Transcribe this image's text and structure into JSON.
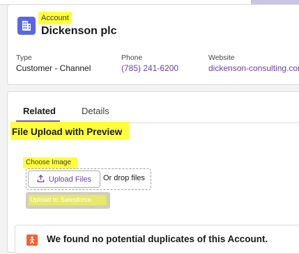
{
  "account": {
    "object_label": "Account",
    "name": "Dickenson plc",
    "fields": [
      {
        "label": "Type",
        "value": "Customer - Channel"
      },
      {
        "label": "Phone",
        "value": "(785) 241-6200"
      },
      {
        "label": "Website",
        "value": "dickenson-consulting.com"
      }
    ],
    "icon": "building-icon"
  },
  "tabs": [
    {
      "label": "Related",
      "active": true
    },
    {
      "label": "Details",
      "active": false
    }
  ],
  "upload": {
    "title": "File Upload with Preview",
    "choose_label": "Choose Image",
    "upload_button_label": "Upload Files",
    "upload_icon": "upload-icon",
    "drop_text": "Or drop files",
    "salesforce_button_label": "Upload to Salesforce"
  },
  "duplicates": {
    "icon": "duplicate-person-icon",
    "message": "We found no potential duplicates of this Account."
  },
  "colors": {
    "highlight": "#ffff3b",
    "account_icon_bg": "#5867e8",
    "link": "#6b3fa0",
    "tab_underline": "#7a55a8",
    "duplicate_icon_bg": "#ff5d2d"
  }
}
